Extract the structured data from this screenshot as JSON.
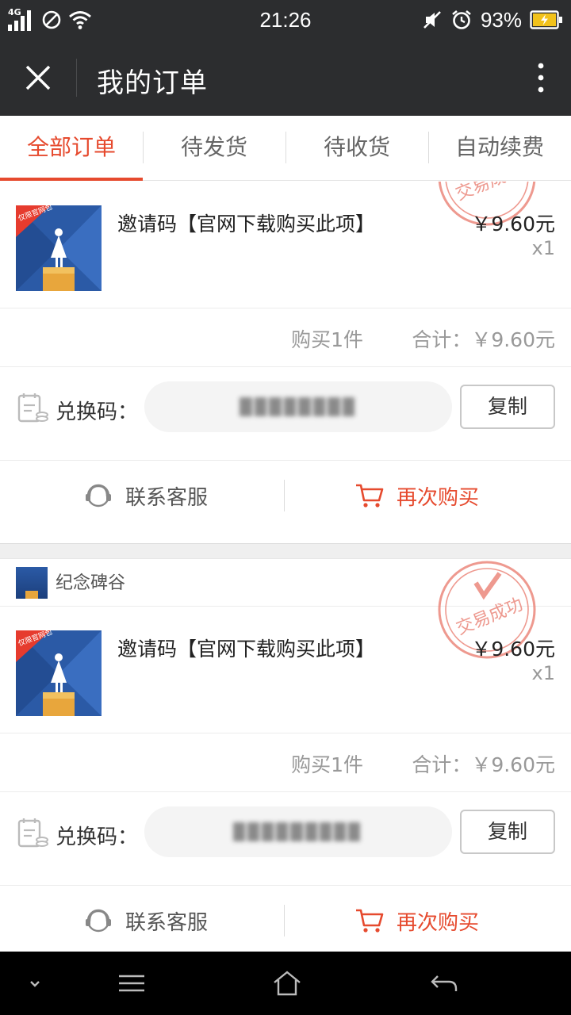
{
  "status_bar": {
    "time": "21:26",
    "network_label": "4G",
    "battery_percent": "93%",
    "icons": [
      "signal-icon",
      "no-sim-icon",
      "wifi-icon",
      "mute-icon",
      "alarm-icon",
      "battery-charging-icon"
    ]
  },
  "header": {
    "title": "我的订单",
    "close_icon": "close-icon",
    "more_icon": "more-vertical-icon"
  },
  "tabs": [
    {
      "label": "全部订单",
      "active": true
    },
    {
      "label": "待发货",
      "active": false
    },
    {
      "label": "待收货",
      "active": false
    },
    {
      "label": "自动续费",
      "active": false
    }
  ],
  "orders": [
    {
      "shop_name": "",
      "stamp_text": "交易成功",
      "product": {
        "thumb_badge": "仅限官网包",
        "name": "邀请码【官网下载购买此项】",
        "price": "￥9.60元",
        "quantity": "x1"
      },
      "summary": {
        "count": "购买1件",
        "total": "合计：￥9.60元"
      },
      "code_label": "兑换码：",
      "copy_label": "复制",
      "support_label": "联系客服",
      "rebuy_label": "再次购买"
    },
    {
      "shop_name": "纪念碑谷",
      "stamp_text": "交易成功",
      "product": {
        "thumb_badge": "仅限官网包",
        "name": "邀请码【官网下载购买此项】",
        "price": "￥9.60元",
        "quantity": "x1"
      },
      "summary": {
        "count": "购买1件",
        "total": "合计：￥9.60元"
      },
      "code_label": "兑换码：",
      "copy_label": "复制",
      "support_label": "联系客服",
      "rebuy_label": "再次购买"
    }
  ],
  "nav_bar": {
    "icons": [
      "chevron-down-icon",
      "menu-icon",
      "home-icon",
      "back-icon"
    ]
  },
  "colors": {
    "accent": "#e64a2e",
    "header_bg": "#2c2d2f",
    "stamp": "#e8776a"
  }
}
